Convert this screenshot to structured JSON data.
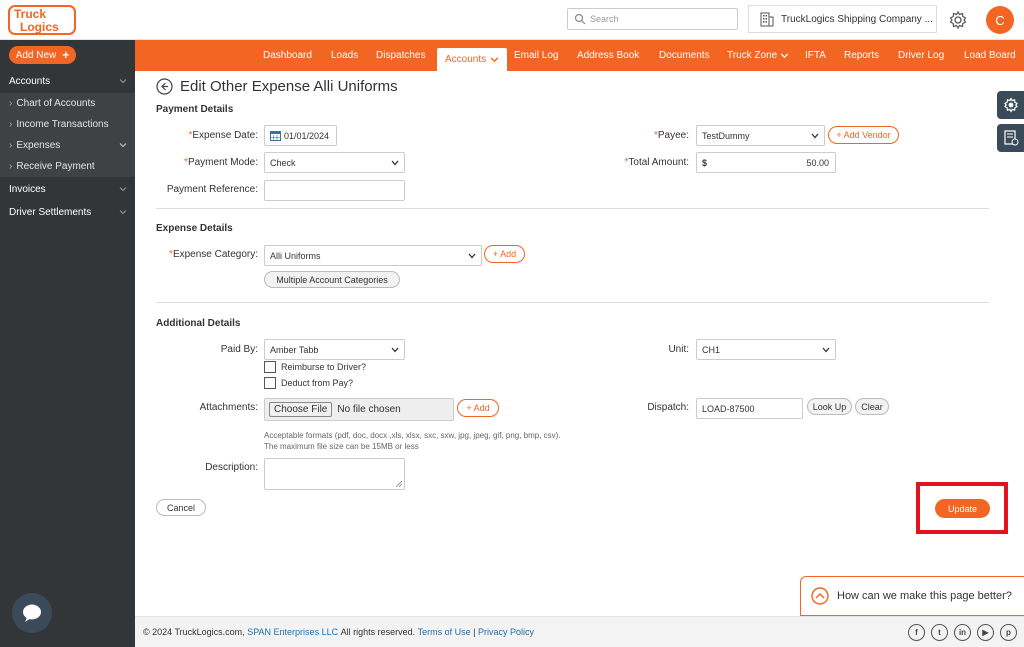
{
  "app": {
    "logo_text": "TruckLogics",
    "brand_color": "#f26522",
    "search_placeholder": "Search",
    "company_name": "TruckLogics Shipping Company ...",
    "avatar_initial": "C"
  },
  "sidebar": {
    "add_new_label": "Add New",
    "items": [
      {
        "label": "Accounts",
        "type": "header"
      },
      {
        "label": "Chart of Accounts",
        "type": "sub"
      },
      {
        "label": "Income Transactions",
        "type": "sub"
      },
      {
        "label": "Expenses",
        "type": "sub"
      },
      {
        "label": "Receive Payment",
        "type": "sub"
      },
      {
        "label": "Invoices",
        "type": "header"
      },
      {
        "label": "Driver Settlements",
        "type": "header"
      }
    ]
  },
  "nav": {
    "items": [
      "Dashboard",
      "Loads",
      "Dispatches",
      "Accounts",
      "Email Log",
      "Address Book",
      "Documents",
      "Truck Zone",
      "IFTA",
      "Reports",
      "Driver Log",
      "Load Board"
    ],
    "active": "Accounts"
  },
  "page": {
    "title": "Edit Other Expense Alli Uniforms"
  },
  "payment_details": {
    "heading": "Payment Details",
    "expense_date_label": "Expense Date:",
    "expense_date_value": "01/01/2024",
    "payment_mode_label": "Payment Mode:",
    "payment_mode_value": "Check",
    "payment_reference_label": "Payment Reference:",
    "payment_reference_value": "",
    "payee_label": "Payee:",
    "payee_value": "TestDummy",
    "add_vendor_label": "Add Vendor",
    "total_amount_label": "Total Amount:",
    "currency_symbol": "$",
    "total_amount_value": "50.00"
  },
  "expense_details": {
    "heading": "Expense Details",
    "category_label": "Expense Category:",
    "category_value": "Alli Uniforms",
    "add_label": "Add",
    "multiple_label": "Multiple Account Categories"
  },
  "additional_details": {
    "heading": "Additional Details",
    "paid_by_label": "Paid By:",
    "paid_by_value": "Amber Tabb",
    "reimburse_label": "Reimburse to Driver?",
    "deduct_label": "Deduct from Pay?",
    "attachments_label": "Attachments:",
    "choose_file_label": "Choose File",
    "no_file_label": "No file chosen",
    "add_label": "Add",
    "formats_hint": "Acceptable formats (pdf, doc, docx ,xls, xlsx, sxc, sxw, jpg, jpeg, gif, png, bmp, csv).",
    "size_hint": "The maximum file size can be 15MB or less",
    "description_label": "Description:",
    "unit_label": "Unit:",
    "unit_value": "CH1",
    "dispatch_label": "Dispatch:",
    "dispatch_value": "LOAD-87500",
    "lookup_label": "Look Up",
    "clear_label": "Clear"
  },
  "actions": {
    "cancel_label": "Cancel",
    "update_label": "Update"
  },
  "feedback": {
    "label": "How can we make this page better?"
  },
  "footer": {
    "copyright": "© 2024 TruckLogics.com,",
    "company_link": "SPAN Enterprises LLC",
    "rights": "All rights reserved.",
    "terms": "Terms of Use",
    "separator": "|",
    "privacy": "Privacy Policy",
    "social": [
      "f",
      "t",
      "in",
      "▶",
      "p"
    ]
  }
}
